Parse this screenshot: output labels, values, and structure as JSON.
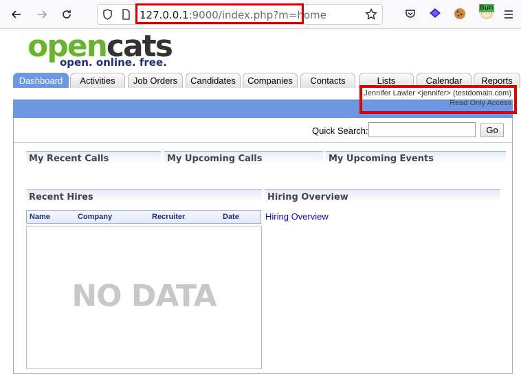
{
  "browser": {
    "url_host": "127.0.0.1",
    "url_rest": ":9000/index.php?m=home",
    "bun_label": "Bun"
  },
  "logo": {
    "word_open": "open",
    "word_cats": "cats",
    "tagline": "open. online. free."
  },
  "tabs": [
    {
      "label": "Dashboard",
      "active": true
    },
    {
      "label": "Activities"
    },
    {
      "label": "Job Orders"
    },
    {
      "label": "Candidates"
    },
    {
      "label": "Companies"
    },
    {
      "label": "Contacts"
    },
    {
      "label": "Lists"
    },
    {
      "label": "Calendar"
    },
    {
      "label": "Reports"
    }
  ],
  "user": {
    "line": "Jennifer Lawler <jennifer> (testdomain.com)",
    "access": "Read Only Access"
  },
  "quick_search": {
    "label": "Quick Search:",
    "value": "",
    "go_label": "Go"
  },
  "sections": {
    "recent_calls": "My Recent Calls",
    "upcoming_calls": "My Upcoming Calls",
    "upcoming_events": "My Upcoming Events",
    "recent_hires": "Recent Hires",
    "hiring_overview": "Hiring Overview"
  },
  "hires_table": {
    "columns": [
      "Name",
      "Company",
      "Recruiter",
      "Date"
    ],
    "empty_text": "NO DATA"
  },
  "hiring_overview_link": "Hiring Overview",
  "colors": {
    "accent_blue": "#6b97e3",
    "highlight_red": "#e00000",
    "logo_green": "#6ab42d",
    "link_blue": "#0a0ad0"
  }
}
